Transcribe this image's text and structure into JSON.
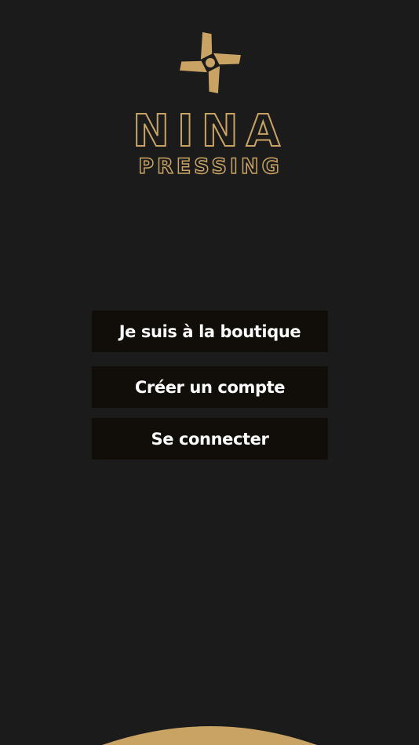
{
  "logo": {
    "icon": "pinwheel-logo-icon",
    "brand_line1": "NINA",
    "brand_line2": "PRESSING"
  },
  "actions": {
    "in_store_label": "Je suis à la boutique",
    "create_account_label": "Créer un compte",
    "login_label": "Se connecter"
  },
  "colors": {
    "background": "#1b1b1c",
    "gold": "#c9a363",
    "button_bg": "#110e09",
    "button_text": "#ffffff"
  }
}
